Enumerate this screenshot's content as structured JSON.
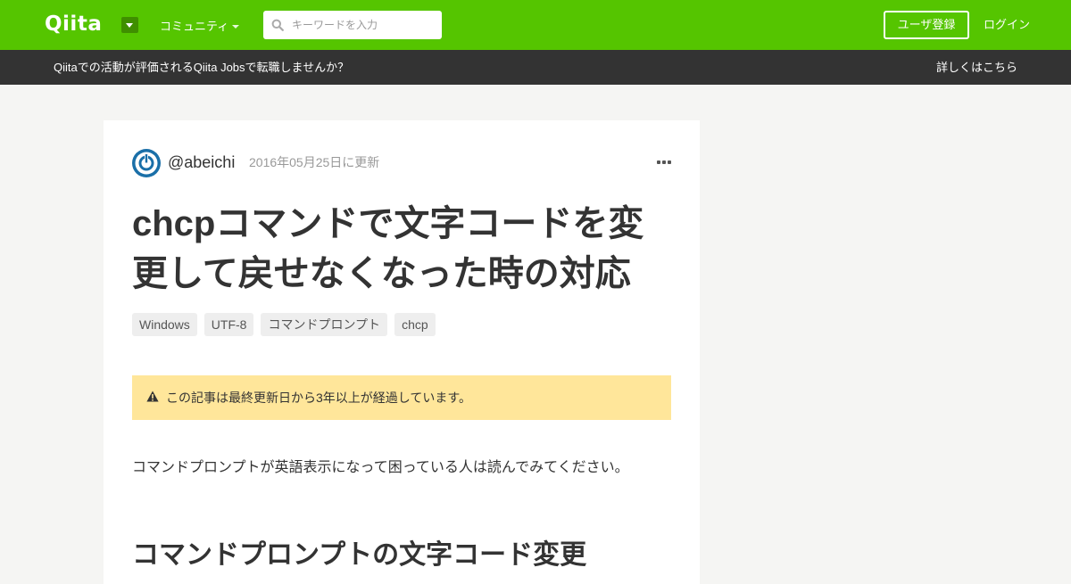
{
  "header": {
    "logo": "Qiita",
    "community_label": "コミュニティ",
    "search": {
      "placeholder": "キーワードを入力",
      "value": ""
    },
    "signup_label": "ユーザ登録",
    "login_label": "ログイン",
    "accent_color": "#55c500"
  },
  "promo": {
    "text": "Qiitaでの活動が評価されるQiita Jobsで転職しませんか？",
    "link_label": "詳しくはこちら"
  },
  "article": {
    "author": "@abeichi",
    "updated": "2016年05月25日に更新",
    "title": "chcpコマンドで文字コードを変更して戻せなくなった時の対応",
    "tags": [
      "Windows",
      "UTF-8",
      "コマンドプロンプト",
      "chcp"
    ],
    "notice": "この記事は最終更新日から3年以上が経過しています。",
    "intro": "コマンドプロンプトが英語表示になって困っている人は読んでみてください。",
    "section_heading": "コマンドプロンプトの文字コード変更"
  }
}
